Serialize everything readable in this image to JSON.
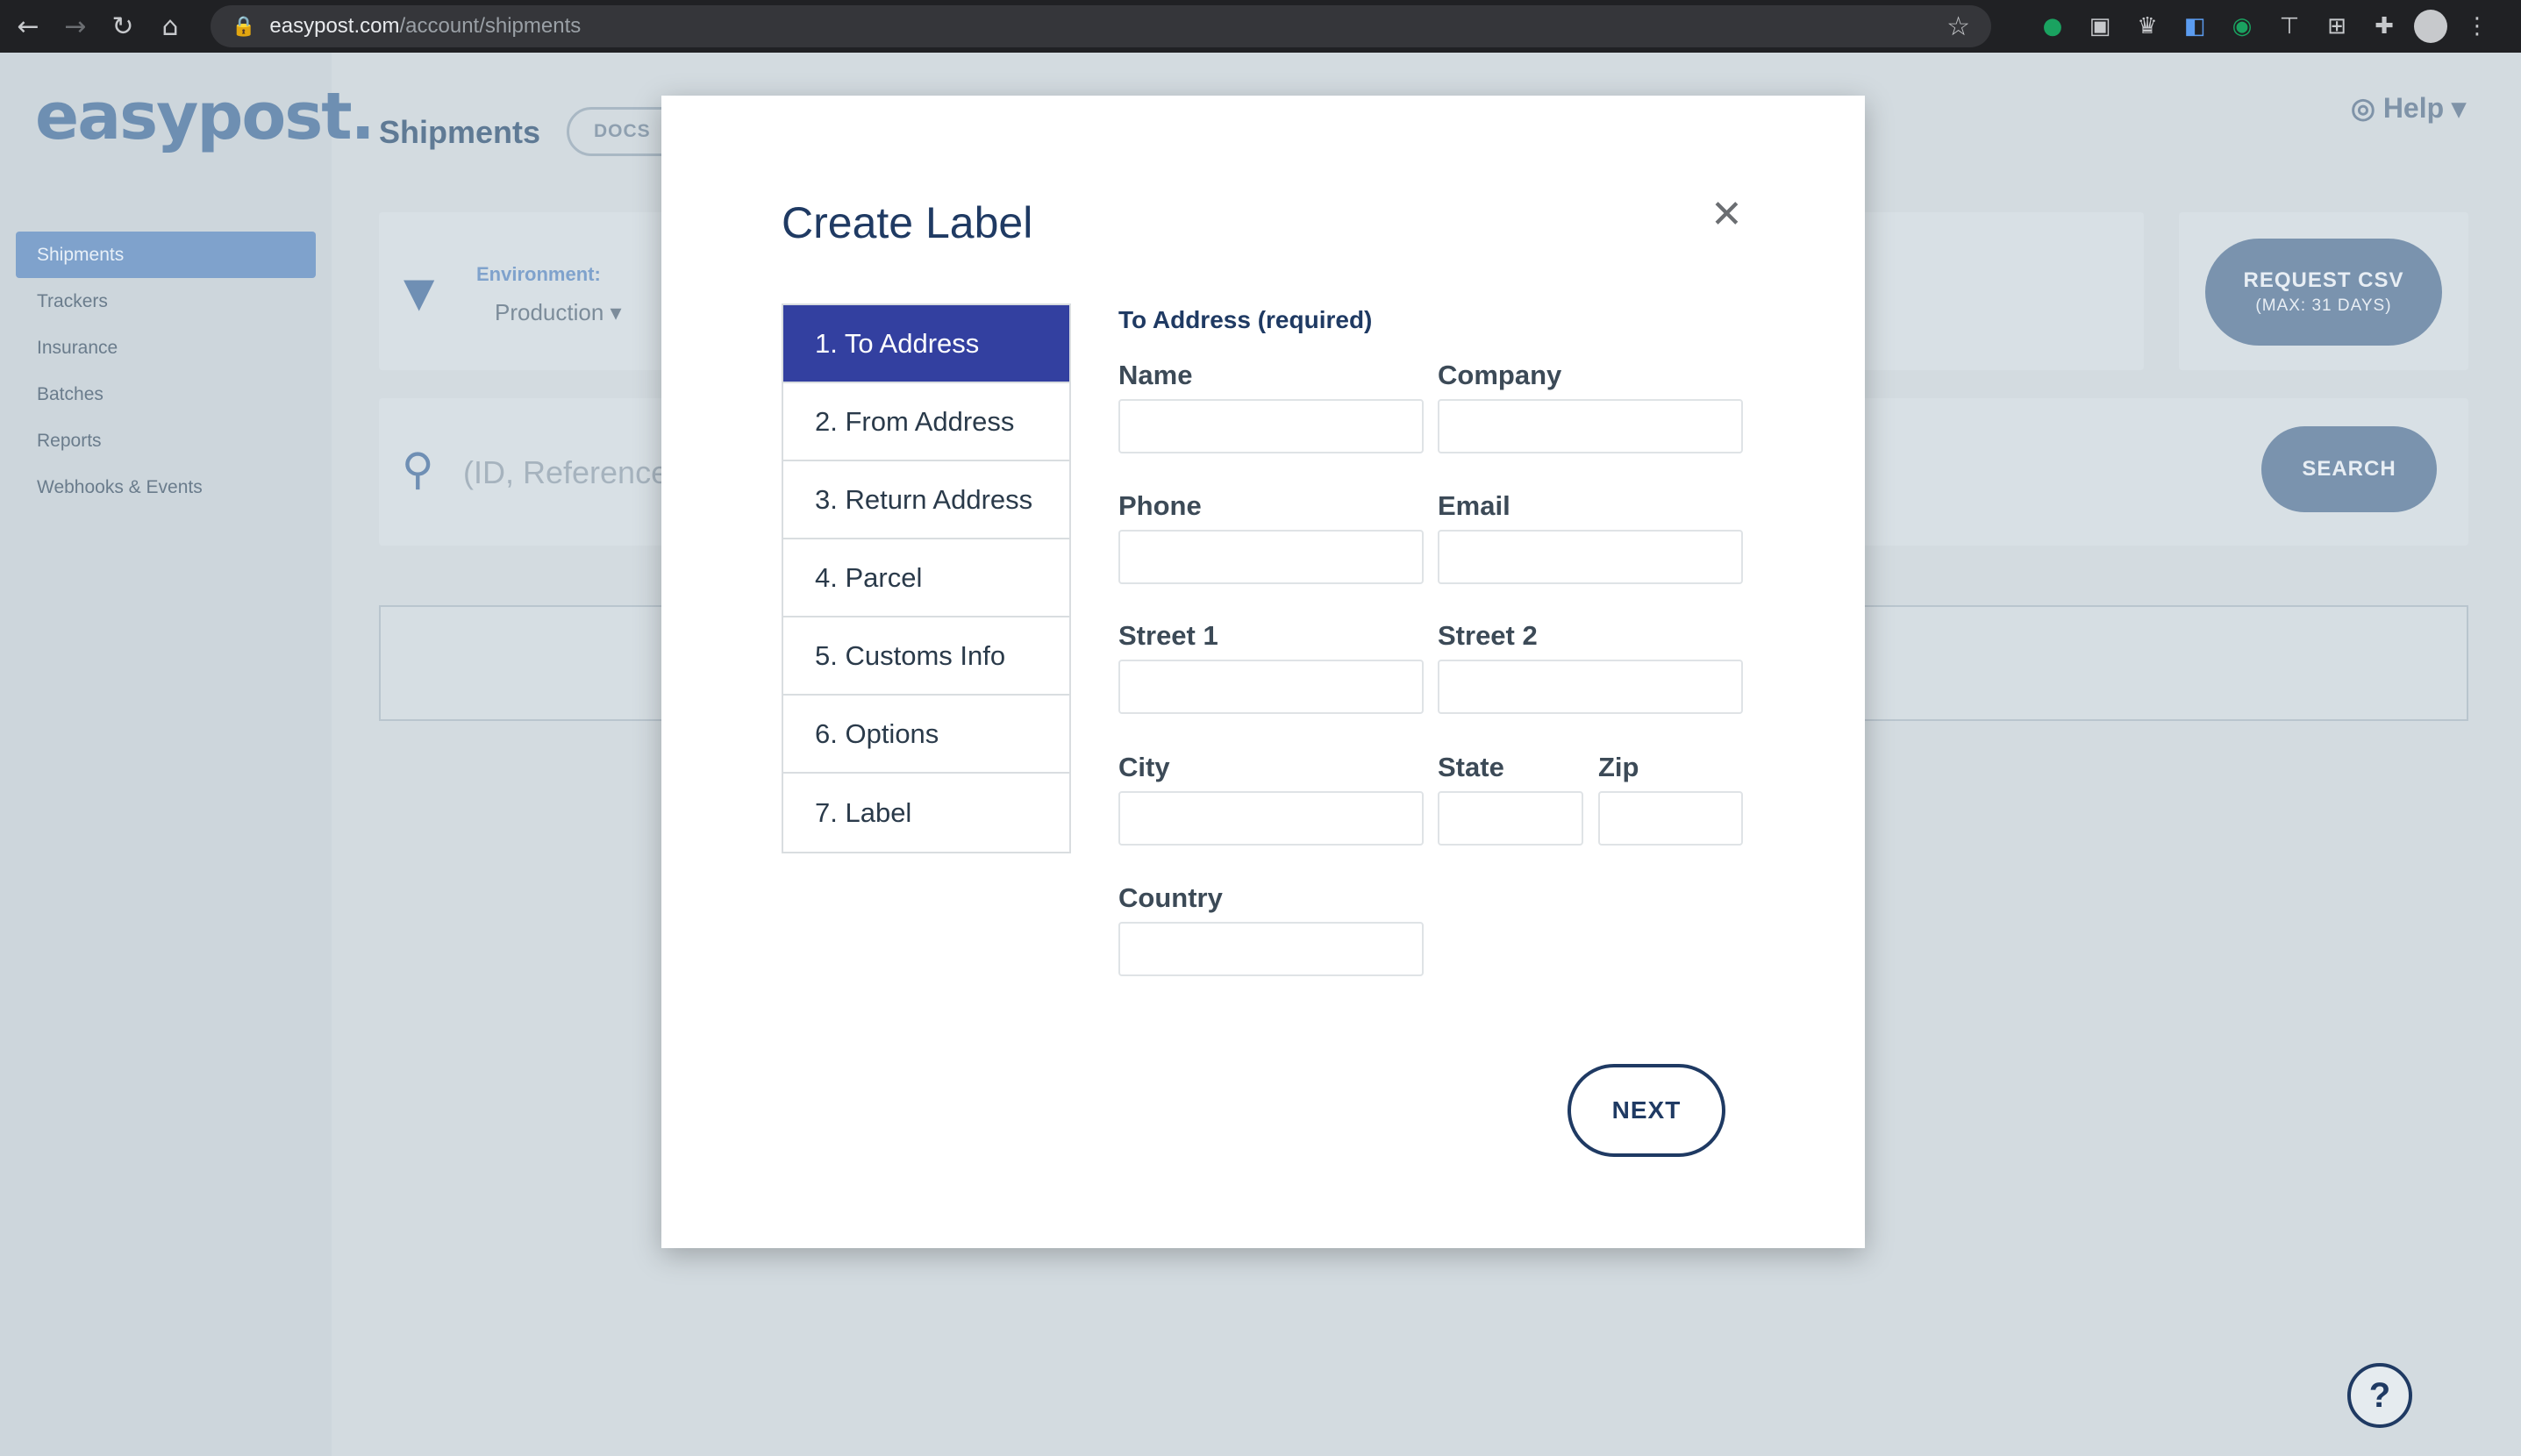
{
  "browser": {
    "url_domain": "easypost.com",
    "url_path": "/account/shipments",
    "nav": {
      "back": "←",
      "forward": "→",
      "reload": "↻",
      "home": "⌂"
    },
    "lock_icon": "🔒",
    "star_icon": "☆"
  },
  "app": {
    "logo": "easypost.",
    "page_title": "Shipments",
    "docs_label": "DOCS",
    "help_label": "Help ▾",
    "sidebar": {
      "items": [
        {
          "label": "Shipments"
        },
        {
          "label": "Trackers"
        },
        {
          "label": "Insurance"
        },
        {
          "label": "Batches"
        },
        {
          "label": "Reports"
        },
        {
          "label": "Webhooks & Events"
        }
      ]
    },
    "filter": {
      "environment_label": "Environment:",
      "environment_value": "Production ▾"
    },
    "request_csv": {
      "line1": "REQUEST CSV",
      "line2": "(MAX: 31 DAYS)"
    },
    "search": {
      "placeholder": "(ID, Reference",
      "button": "SEARCH"
    },
    "help_button": "?"
  },
  "modal": {
    "title": "Create Label",
    "close": "✕",
    "steps": [
      {
        "label": "1. To Address"
      },
      {
        "label": "2. From Address"
      },
      {
        "label": "3. Return Address"
      },
      {
        "label": "4. Parcel"
      },
      {
        "label": "5. Customs Info"
      },
      {
        "label": "6. Options"
      },
      {
        "label": "7. Label"
      }
    ],
    "form": {
      "section_title": "To Address (required)",
      "name": "Name",
      "company": "Company",
      "phone": "Phone",
      "email": "Email",
      "street1": "Street 1",
      "street2": "Street 2",
      "city": "City",
      "state": "State",
      "zip": "Zip",
      "country": "Country"
    },
    "next_button": "NEXT"
  }
}
